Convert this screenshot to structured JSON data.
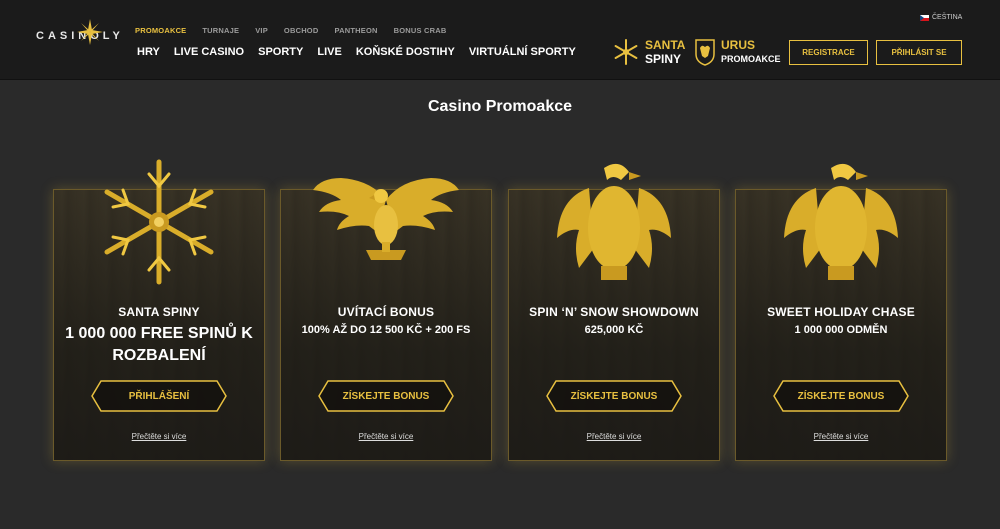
{
  "header": {
    "logo_text": "CASINOLY",
    "language": "ČEŠTINA",
    "subnav": [
      "PROMOAKCE",
      "TURNAJE",
      "VIP",
      "OBCHOD",
      "PANTHEON",
      "BONUS CRAB"
    ],
    "mainnav": [
      "HRY",
      "LIVE CASINO",
      "SPORTY",
      "LIVE",
      "KOŇSKÉ DOSTIHY",
      "VIRTUÁLNÍ SPORTY"
    ],
    "promo_santa": {
      "line1": "SANTA",
      "line2": "SPINY"
    },
    "promo_urus": {
      "line1": "URUS",
      "line2": "PROMOAKCE"
    },
    "register_label": "REGISTRACE",
    "login_label": "PŘIHLÁSIT SE"
  },
  "page_title": "Casino Promoakce",
  "cards": [
    {
      "title": "SANTA SPINY",
      "subtitle": "1 000 000 FREE SPINŮ K ROZBALENÍ",
      "button": "PŘIHLÁŠENÍ",
      "link": "Přečtěte si více",
      "art": "snowflake-icon"
    },
    {
      "title": "UVÍTACÍ BONUS",
      "subtitle": "100% AŽ DO 12 500 KČ + 200 FS",
      "button": "ZÍSKEJTE BONUS",
      "link": "Přečtěte si více",
      "art": "eagle-spread-icon"
    },
    {
      "title": "SPIN ‘N’ SNOW SHOWDOWN",
      "subtitle": "625,000 KČ",
      "button": "ZÍSKEJTE BONUS",
      "link": "Přečtěte si více",
      "art": "eagle-icon"
    },
    {
      "title": "SWEET HOLIDAY CHASE",
      "subtitle": "1 000 000 ODMĚN",
      "button": "ZÍSKEJTE BONUS",
      "link": "Přečtěte si více",
      "art": "eagle-icon"
    }
  ],
  "colors": {
    "accent": "#e8c040",
    "header_bg": "#1b1b1b",
    "page_bg": "#2a2a2a"
  }
}
